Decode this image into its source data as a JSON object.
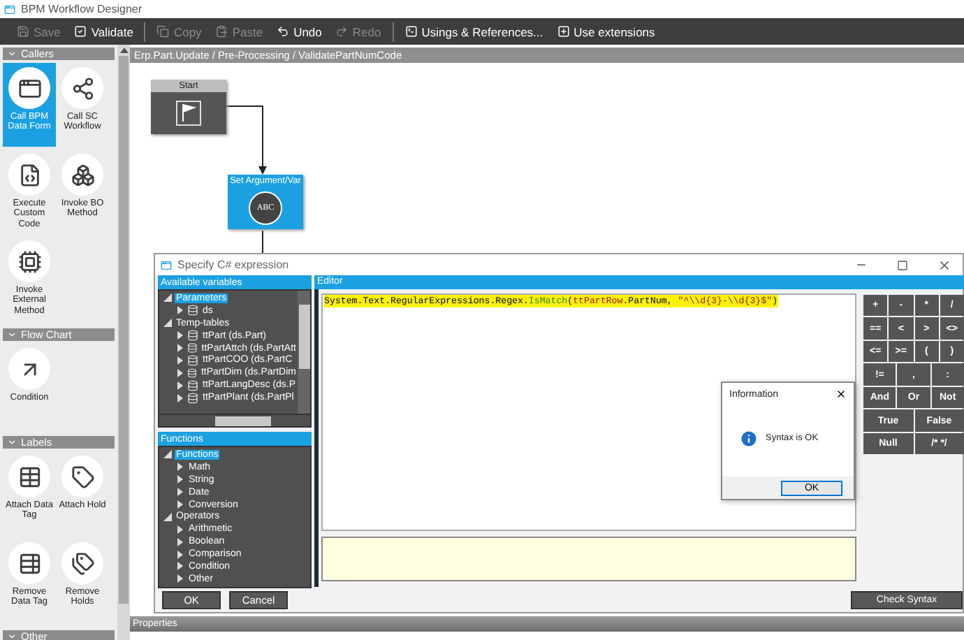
{
  "window": {
    "title": "BPM Workflow Designer"
  },
  "toolbar": [
    {
      "label": "Save",
      "disabled": true
    },
    {
      "label": "Validate",
      "disabled": false
    },
    {
      "label": "Copy",
      "disabled": true
    },
    {
      "label": "Paste",
      "disabled": true
    },
    {
      "label": "Undo",
      "disabled": false
    },
    {
      "label": "Redo",
      "disabled": true
    },
    {
      "label": "Usings & References...",
      "disabled": false
    },
    {
      "label": "Use extensions",
      "disabled": false
    }
  ],
  "palette": {
    "sections": [
      {
        "title": "Callers",
        "items": [
          {
            "label": "Call BPM Data Form",
            "selected": true
          },
          {
            "label": "Call SC Workflow",
            "selected": false
          },
          {
            "label": "Execute Custom Code",
            "selected": false
          },
          {
            "label": "Invoke BO Method",
            "selected": false
          },
          {
            "label": "Invoke External Method",
            "selected": false
          }
        ]
      },
      {
        "title": "Flow Chart",
        "items": [
          {
            "label": "Condition",
            "selected": false
          }
        ]
      },
      {
        "title": "Labels",
        "items": [
          {
            "label": "Attach Data Tag",
            "selected": false
          },
          {
            "label": "Attach Hold",
            "selected": false
          },
          {
            "label": "Remove Data Tag",
            "selected": false
          },
          {
            "label": "Remove Holds",
            "selected": false
          }
        ]
      },
      {
        "title": "Other"
      }
    ]
  },
  "breadcrumb": "Erp.Part.Update / Pre-Processing / ValidatePartNumCode",
  "nodes": [
    {
      "kind": "start",
      "title": "Start"
    },
    {
      "kind": "action",
      "title": "Set Argument/Var",
      "badge": "ABC"
    }
  ],
  "properties_bar": "Properties",
  "dialog": {
    "title": "Specify C# expression",
    "variables": {
      "title": "Available variables",
      "tree": [
        {
          "label": "Parameters",
          "expanded": true,
          "selected": true,
          "children": [
            {
              "label": "ds",
              "kind": "table",
              "expanded": false,
              "selected": false
            }
          ]
        },
        {
          "label": "Temp-tables",
          "expanded": true,
          "selected": false,
          "children": [
            {
              "label": "ttPart (ds.Part)",
              "kind": "table",
              "expanded": false,
              "selected": false
            },
            {
              "label": "ttPartAttch (ds.PartAtt",
              "kind": "table",
              "expanded": false,
              "selected": false
            },
            {
              "label": "ttPartCOO (ds.PartC",
              "kind": "table",
              "expanded": false,
              "selected": false
            },
            {
              "label": "ttPartDim (ds.PartDim",
              "kind": "table",
              "expanded": false,
              "selected": false
            },
            {
              "label": "ttPartLangDesc (ds.P",
              "kind": "table",
              "expanded": false,
              "selected": false
            },
            {
              "label": "ttPartPlant (ds.PartPl",
              "kind": "table",
              "expanded": false,
              "selected": false
            }
          ]
        }
      ]
    },
    "functions": {
      "title": "Functions",
      "tree": [
        {
          "label": "Functions",
          "expanded": true,
          "selected": true,
          "children": [
            {
              "label": "Math",
              "expanded": false,
              "selected": false
            },
            {
              "label": "String",
              "expanded": false,
              "selected": false
            },
            {
              "label": "Date",
              "expanded": false,
              "selected": false
            },
            {
              "label": "Conversion",
              "expanded": false,
              "selected": false
            }
          ]
        },
        {
          "label": "Operators",
          "expanded": true,
          "selected": false,
          "children": [
            {
              "label": "Arithmetic",
              "expanded": false,
              "selected": false
            },
            {
              "label": "Boolean",
              "expanded": false,
              "selected": false
            },
            {
              "label": "Comparison",
              "expanded": false,
              "selected": false
            },
            {
              "label": "Condition",
              "expanded": false,
              "selected": false
            },
            {
              "label": "Other",
              "expanded": false,
              "selected": false
            }
          ]
        }
      ]
    },
    "editor": {
      "title": "Editor",
      "code": [
        {
          "kind": "plain",
          "text": "System.Text.RegularExpressions.Regex."
        },
        {
          "kind": "method",
          "text": "IsMatch"
        },
        {
          "kind": "plain",
          "text": "("
        },
        {
          "kind": "variable",
          "text": "ttPartRow"
        },
        {
          "kind": "plain",
          "text": ".PartNum, "
        },
        {
          "kind": "string",
          "text": "\"^\\\\d{3}-\\\\d{3}$\""
        },
        {
          "kind": "plain",
          "text": ")"
        }
      ]
    },
    "keypad": [
      [
        "+",
        "-",
        "*",
        "/"
      ],
      [
        "==",
        "<",
        ">",
        "<>"
      ],
      [
        "<=",
        ">=",
        "(",
        ")"
      ],
      [
        "!=",
        ",",
        ":"
      ],
      [
        "And",
        "Or",
        "Not"
      ],
      [
        "True",
        "False"
      ],
      [
        "Null",
        "/* */"
      ]
    ],
    "buttons": [
      "OK",
      "Cancel"
    ],
    "check_button": "Check Syntax"
  },
  "message_box": {
    "title": "Information",
    "message": "Syntax is OK",
    "button": "OK"
  }
}
